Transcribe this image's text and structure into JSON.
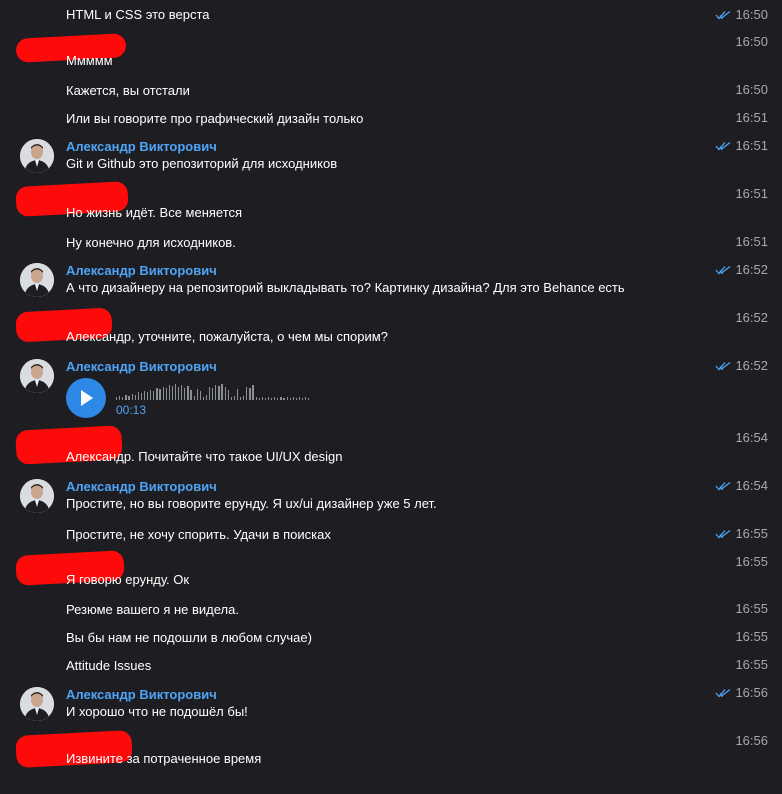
{
  "colors": {
    "background": "#1e1e22",
    "sender_name": "#4ea4f6",
    "read_checks": "#4ea4f6",
    "time": "#a3a8ae",
    "redaction": "#ff0a0a",
    "play_button": "#2d88e6"
  },
  "messages": [
    {
      "text": "HTML и CSS это верста",
      "time": "16:50",
      "read": true
    },
    {
      "text": "Ммммм",
      "time": "16:50",
      "read": false
    },
    {
      "text": "Кажется, вы отстали",
      "time": "16:50",
      "read": false
    },
    {
      "text": "Или вы говорите про графический  дизайн только",
      "time": "16:51",
      "read": false
    },
    {
      "sender": "Александр Викторович",
      "text": "Git и Github это репозиторий для исходников",
      "time": "16:51",
      "read": true
    },
    {
      "text": "Но жизнь идёт. Все меняется",
      "time": "16:51",
      "read": false
    },
    {
      "text": "Ну конечно для исходников.",
      "time": "16:51",
      "read": false
    },
    {
      "sender": "Александр Викторович",
      "text": "А что дизайнеру на репозиторий выкладывать то? Картинку дизайна? Для это Behance есть",
      "time": "16:52",
      "read": true
    },
    {
      "text": "Александр, уточните, пожалуйста, о чем мы спорим?",
      "time": "16:52",
      "read": false
    },
    {
      "sender": "Александр Викторович",
      "voice": {
        "duration": "00:13",
        "icon": "play-icon"
      },
      "time": "16:52",
      "read": true
    },
    {
      "text": "Александр. Почитайте что такое UI/UX design",
      "time": "16:54",
      "read": false
    },
    {
      "sender": "Александр Викторович",
      "text": "Простите, но вы говорите ерунду. Я ux/ui дизайнер уже 5 лет.",
      "time": "16:54",
      "read": true
    },
    {
      "text": "Простите, не хочу спорить. Удачи в поисках",
      "time": "16:55",
      "read": true
    },
    {
      "text": "Я говорю ерунду. Ок",
      "time": "16:55",
      "read": false
    },
    {
      "text": "Резюме вашего я не видела.",
      "time": "16:55",
      "read": false
    },
    {
      "text": "Вы бы нам не подошли в любом случае)",
      "time": "16:55",
      "read": false
    },
    {
      "text": "Attitude Issues",
      "time": "16:55",
      "read": false
    },
    {
      "sender": "Александр Викторович",
      "text": "И хорошо что не подошёл бы!",
      "time": "16:56",
      "read": true
    },
    {
      "text": "Извините за потраченное время",
      "time": "16:56",
      "read": false
    }
  ]
}
